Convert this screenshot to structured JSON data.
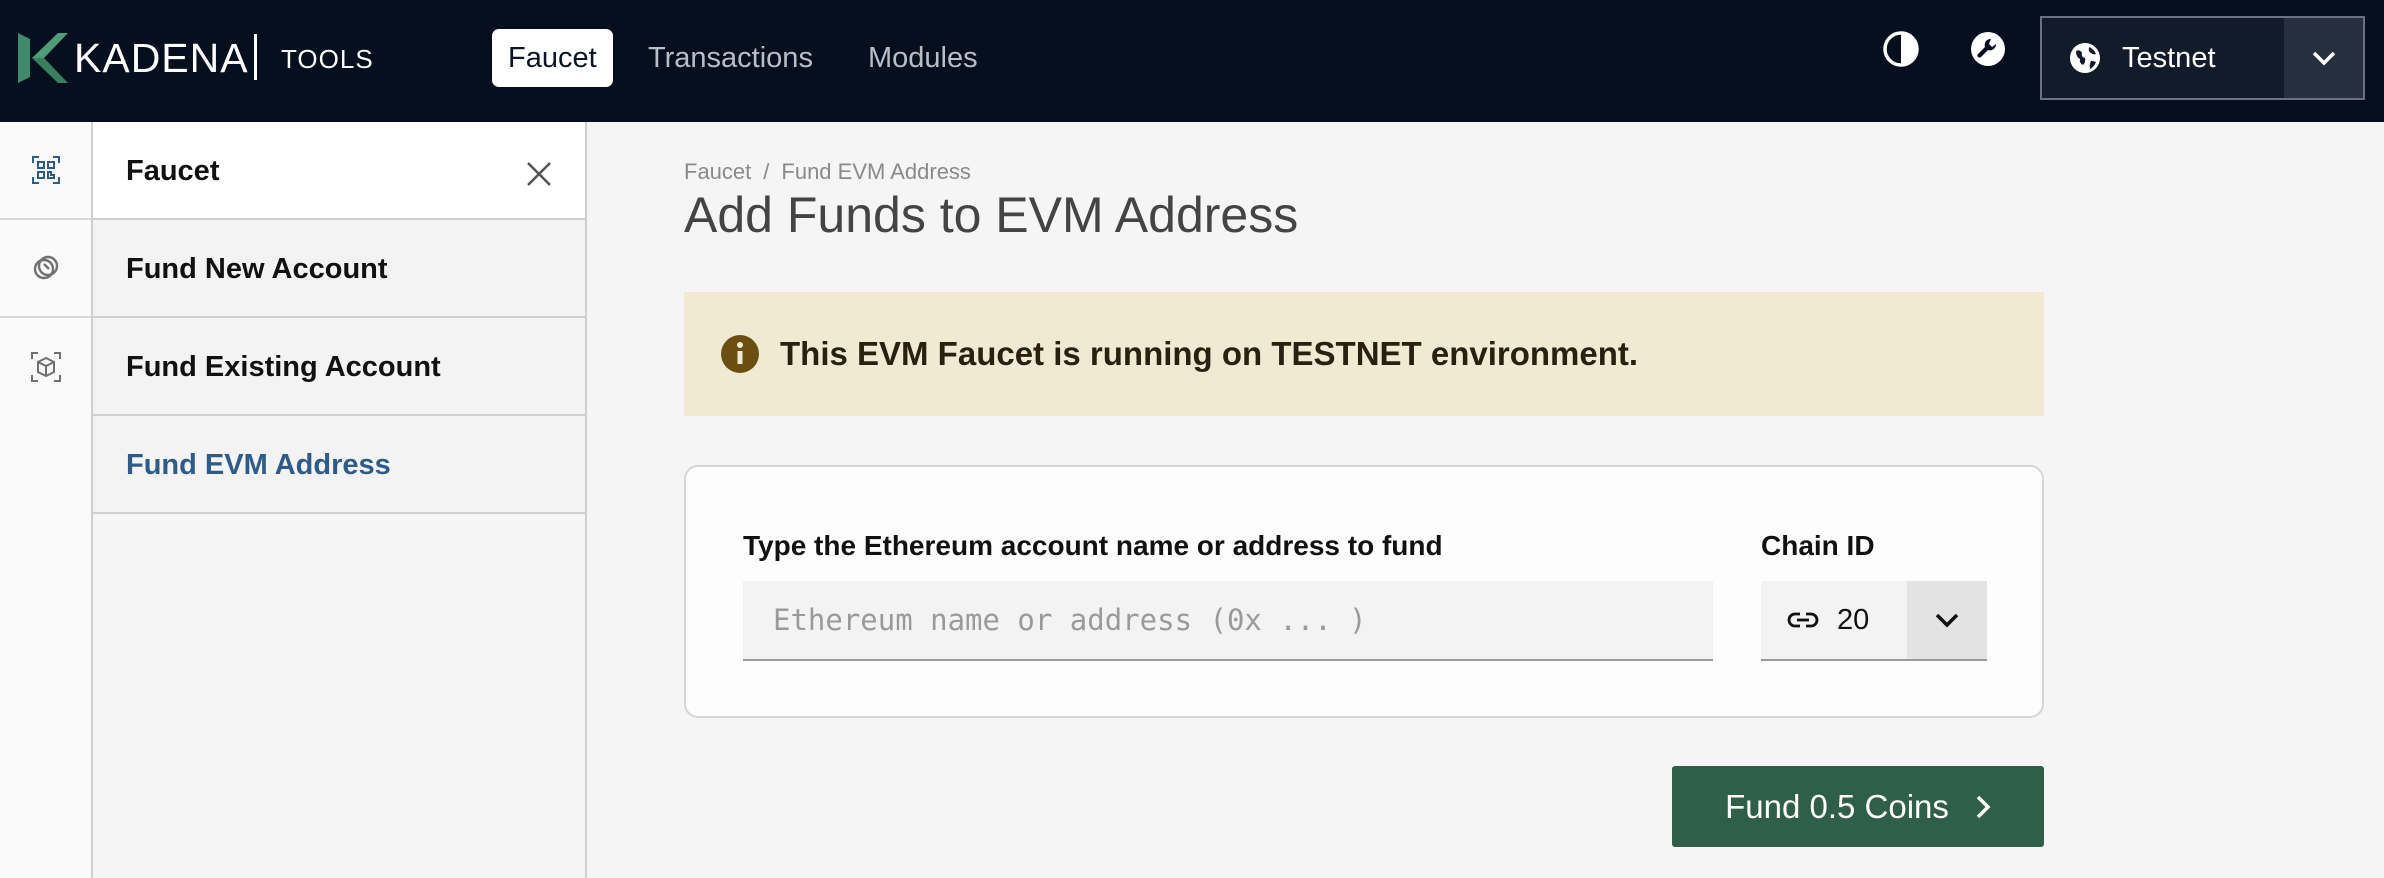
{
  "app": {
    "brand": "KADENA",
    "product": "TOOLS"
  },
  "topnav": {
    "items": [
      {
        "label": "Faucet",
        "active": true
      },
      {
        "label": "Transactions",
        "active": false
      },
      {
        "label": "Modules",
        "active": false
      }
    ],
    "icons": [
      "contrast-icon",
      "wrench-icon"
    ],
    "network": {
      "value": "Testnet",
      "icon": "globe-icon"
    }
  },
  "rail": {
    "icons": [
      "qr-code-icon",
      "coins-icon",
      "cube-icon"
    ]
  },
  "sidebar": {
    "title": "Faucet",
    "items": [
      {
        "label": "Fund New Account",
        "active": false
      },
      {
        "label": "Fund Existing Account",
        "active": false
      },
      {
        "label": "Fund EVM Address",
        "active": true
      }
    ]
  },
  "breadcrumb": {
    "root": "Faucet",
    "separator": "/",
    "current": "Fund EVM Address"
  },
  "page": {
    "title": "Add Funds to EVM Address"
  },
  "alert": {
    "icon": "info-icon",
    "text": "This EVM Faucet is running on TESTNET environment."
  },
  "form": {
    "address_label": "Type the Ethereum account name or address to fund",
    "address_value": "",
    "address_placeholder": "Ethereum name or address (0x ... )",
    "chain_label": "Chain ID",
    "chain_value": "20",
    "submit_label": "Fund 0.5 Coins"
  },
  "colors": {
    "topbar": "#050f1e",
    "accent_link": "#2e5b88",
    "alert_bg": "#f1ead3",
    "alert_icon": "#6b4f12",
    "button": "#2f5e49",
    "logo_green": "#3f8a6a"
  }
}
